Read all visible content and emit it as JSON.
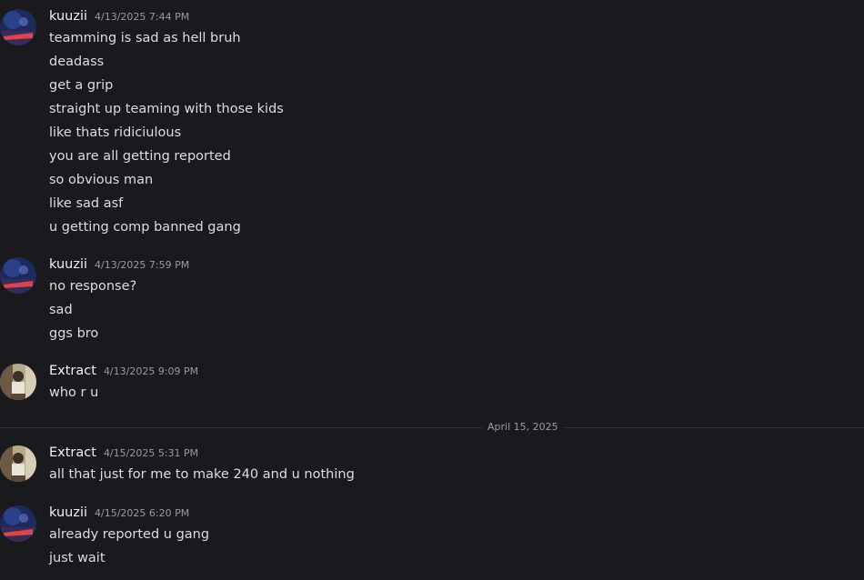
{
  "messages": [
    {
      "author": "kuuzii",
      "timestamp": "4/13/2025 7:44 PM",
      "avatar": "kuuzii-avatar",
      "lines": [
        "teamming is sad as hell bruh",
        "deadass",
        "get a grip",
        "straight up teaming with those kids",
        "like thats ridiciulous",
        "you are all getting reported",
        "so obvious man",
        "like sad asf",
        "u getting comp banned gang"
      ]
    },
    {
      "author": "kuuzii",
      "timestamp": "4/13/2025 7:59 PM",
      "avatar": "kuuzii-avatar",
      "lines": [
        "no response?",
        "sad",
        "ggs bro"
      ]
    },
    {
      "author": "Extract",
      "timestamp": "4/13/2025 9:09 PM",
      "avatar": "extract-avatar",
      "lines": [
        "who r u"
      ]
    },
    {
      "author": "Extract",
      "timestamp": "4/15/2025 5:31 PM",
      "avatar": "extract-avatar",
      "lines": [
        "all that just for me to make 240 and u nothing"
      ]
    },
    {
      "author": "kuuzii",
      "timestamp": "4/15/2025 6:20 PM",
      "avatar": "kuuzii-avatar",
      "lines": [
        "already reported u gang",
        "just wait"
      ]
    }
  ],
  "date_divider": "April 15, 2025",
  "colors": {
    "background": "#1a1a1e",
    "username": "#f2f3f5",
    "timestamp": "#949ba4",
    "message_text": "#dbdee1",
    "divider_line": "#2e2f35"
  }
}
